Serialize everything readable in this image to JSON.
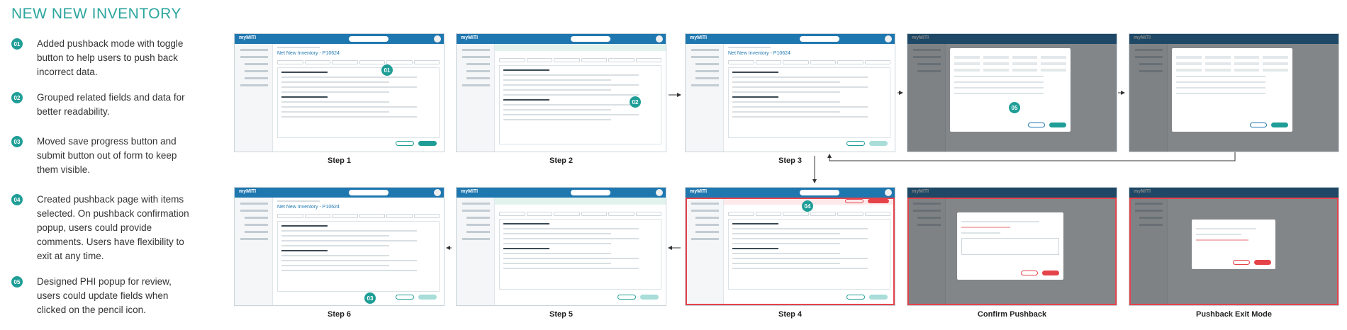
{
  "title": "NEW NEW INVENTORY",
  "notes": [
    {
      "num": "01",
      "text": "Added pushback mode with toggle button to help users to push back incorrect data."
    },
    {
      "num": "02",
      "text": "Grouped related fields and data for better readability."
    },
    {
      "num": "03",
      "text": "Moved save progress button and submit button out of form to keep them visible."
    },
    {
      "num": "04",
      "text": "Created pushback page with items selected. On pushback confirmation popup, users could provide comments. Users have flexibility to exit at any time."
    },
    {
      "num": "05",
      "text": "Designed PHI popup for review, users could update fields when clicked on the pencil icon."
    }
  ],
  "screens": {
    "app_logo": "myMITI",
    "page_title": "Net New Inventory - P10624"
  },
  "steps": [
    {
      "label": "Step 1",
      "badge": "01"
    },
    {
      "label": "Step 2",
      "badge": "02"
    },
    {
      "label": "Step 3",
      "badge": ""
    },
    {
      "label": "",
      "badge": "05"
    },
    {
      "label": "",
      "badge": ""
    },
    {
      "label": "Step 6",
      "badge": "03"
    },
    {
      "label": "Step 5",
      "badge": ""
    },
    {
      "label": "Step 4",
      "badge": "04"
    },
    {
      "label": "Confirm Pushback",
      "badge": ""
    },
    {
      "label": "Pushback Exit Mode",
      "badge": ""
    }
  ],
  "colors": {
    "accent": "#2aa59d",
    "brand_blue": "#1f77b0",
    "alert_red": "#e5434a"
  }
}
